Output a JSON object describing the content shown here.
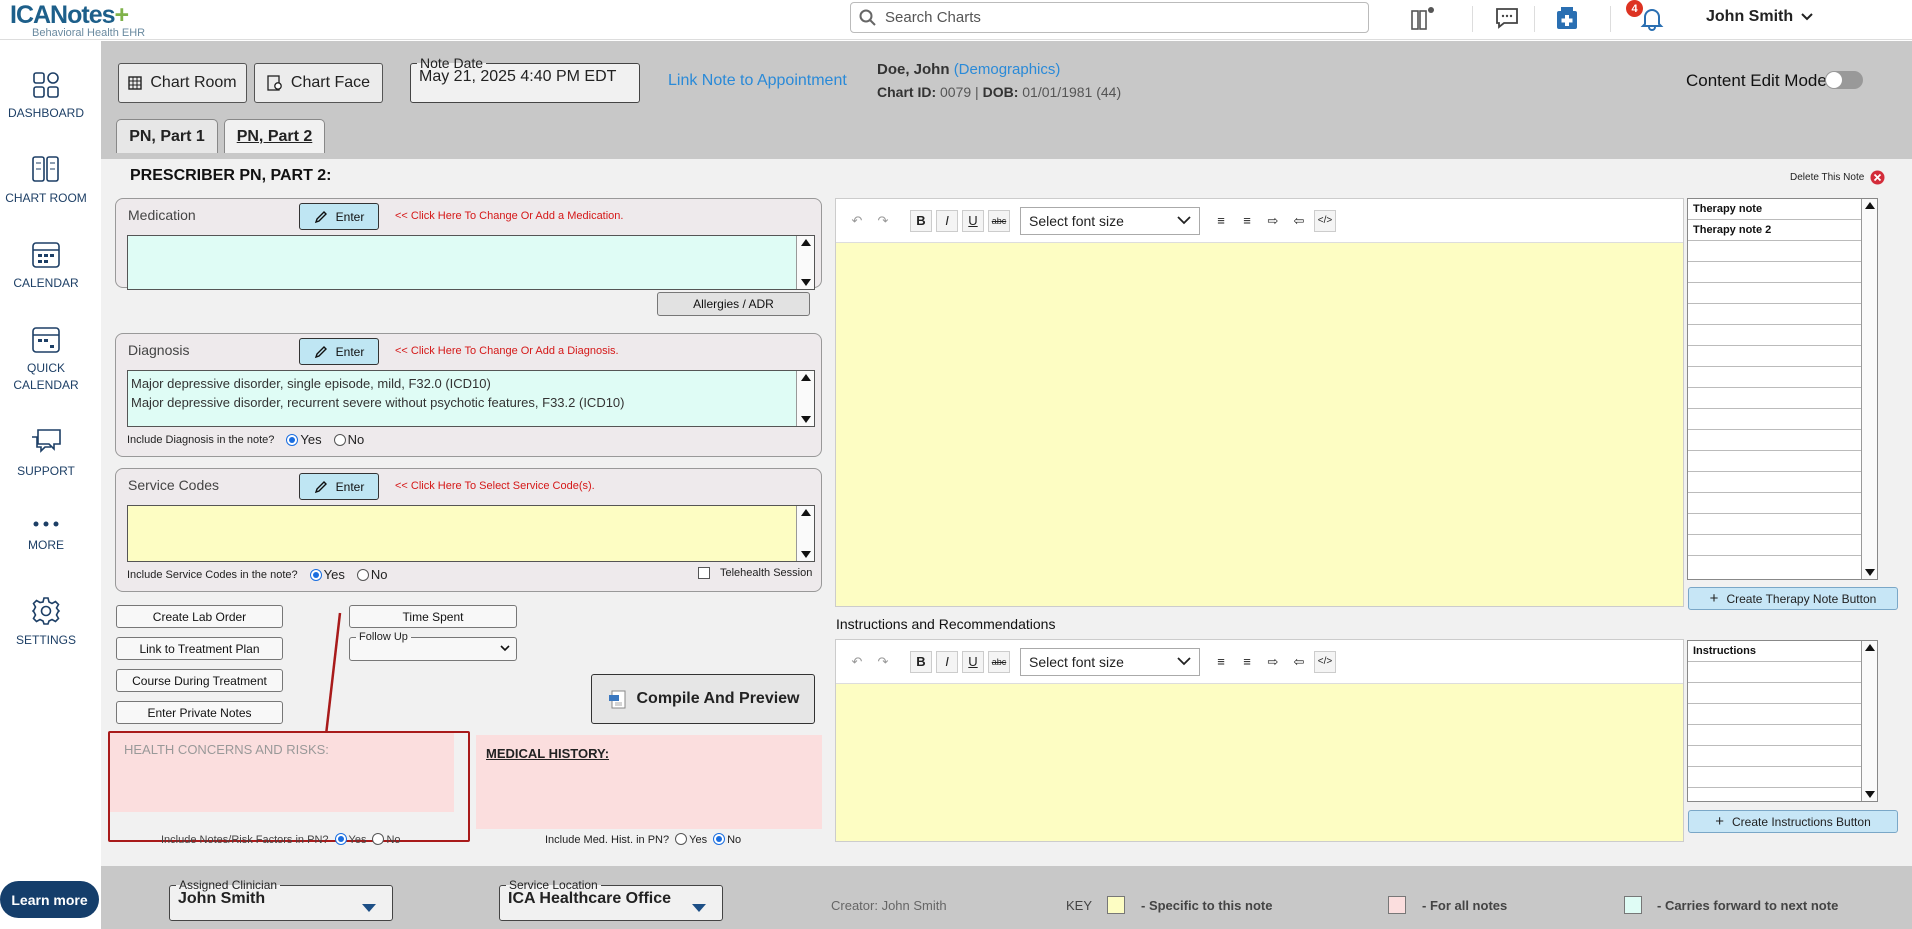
{
  "app": {
    "logo_main": "ICANotes",
    "logo_plus": "+",
    "logo_sub": "Behavioral Health EHR",
    "search_placeholder": "Search Charts",
    "notification_count": "4",
    "user_name": "John Smith"
  },
  "nav": {
    "dashboard": "DASHBOARD",
    "chartroom": "CHART ROOM",
    "calendar": "CALENDAR",
    "quick1": "QUICK",
    "quick2": "CALENDAR",
    "support": "SUPPORT",
    "more": "MORE",
    "settings": "SETTINGS",
    "learn": "Learn more"
  },
  "header": {
    "chart_room": "Chart Room",
    "chart_face": "Chart Face",
    "note_date_label": "Note Date",
    "note_date": "May 21, 2025 4:40 PM EDT",
    "link_appt": "Link Note to Appointment",
    "patient_name": "Doe, John",
    "demographics": "(Demographics)",
    "chart_id_label": "Chart ID:",
    "chart_id": "0079",
    "dob_label": "DOB:",
    "dob": "01/01/1981 (44)",
    "content_edit": "Content Edit Mode"
  },
  "tabs": {
    "t1": "PN, Part 1",
    "t2": "PN, Part 2"
  },
  "page": {
    "title": "PRESCRIBER PN, PART 2:",
    "delete": "Delete This Note"
  },
  "medication": {
    "label": "Medication",
    "enter": "Enter",
    "hint": "<< Click Here To Change Or Add a Medication.",
    "allergies": "Allergies / ADR"
  },
  "diagnosis": {
    "label": "Diagnosis",
    "enter": "Enter",
    "hint": "<< Click Here To Change Or Add a Diagnosis.",
    "line1": "Major depressive disorder, single episode, mild, F32.0 (ICD10)",
    "line2": "Major depressive disorder, recurrent severe without psychotic features, F33.2 (ICD10)",
    "include": "Include Diagnosis in the note?",
    "yes": "Yes",
    "no": "No"
  },
  "service": {
    "label": "Service Codes",
    "enter": "Enter",
    "hint": "<< Click Here To Select Service Code(s).",
    "include": "Include Service Codes in the note?",
    "yes": "Yes",
    "no": "No",
    "telehealth": "Telehealth Session"
  },
  "actions": {
    "lab": "Create Lab Order",
    "treatment": "Link to Treatment Plan",
    "course": "Course During Treatment",
    "private": "Enter Private Notes",
    "time": "Time Spent",
    "followup": "Follow Up",
    "compile": "Compile And Preview"
  },
  "health": {
    "placeholder": "HEALTH CONCERNS AND RISKS:",
    "include": "Include Notes/Risk Factors in PN?",
    "yes": "Yes",
    "no": "No"
  },
  "medhist": {
    "title": "MEDICAL HISTORY:",
    "include": "Include Med. Hist. in PN?",
    "yes": "Yes",
    "no": "No"
  },
  "editor": {
    "font_size": "Select font size",
    "instructions_title": "Instructions and Recommendations"
  },
  "therapy": {
    "items": [
      "Therapy note",
      "Therapy note 2"
    ],
    "create": "Create Therapy Note Button"
  },
  "instructions": {
    "items": [
      "Instructions"
    ],
    "create": "Create Instructions Button"
  },
  "footer": {
    "clinician_label": "Assigned Clinician",
    "clinician": "John Smith",
    "location_label": "Service Location",
    "location": "ICA Healthcare Office",
    "creator": "Creator: John Smith",
    "key": "KEY",
    "k1": "- Specific to this note",
    "k2": "- For all notes",
    "k3": "- Carries forward to next note"
  },
  "colors": {
    "yellow": "#fdfdc3",
    "pink": "#fbdede",
    "cyan": "#dffcf5",
    "annotation_red": "#a81a1a"
  }
}
